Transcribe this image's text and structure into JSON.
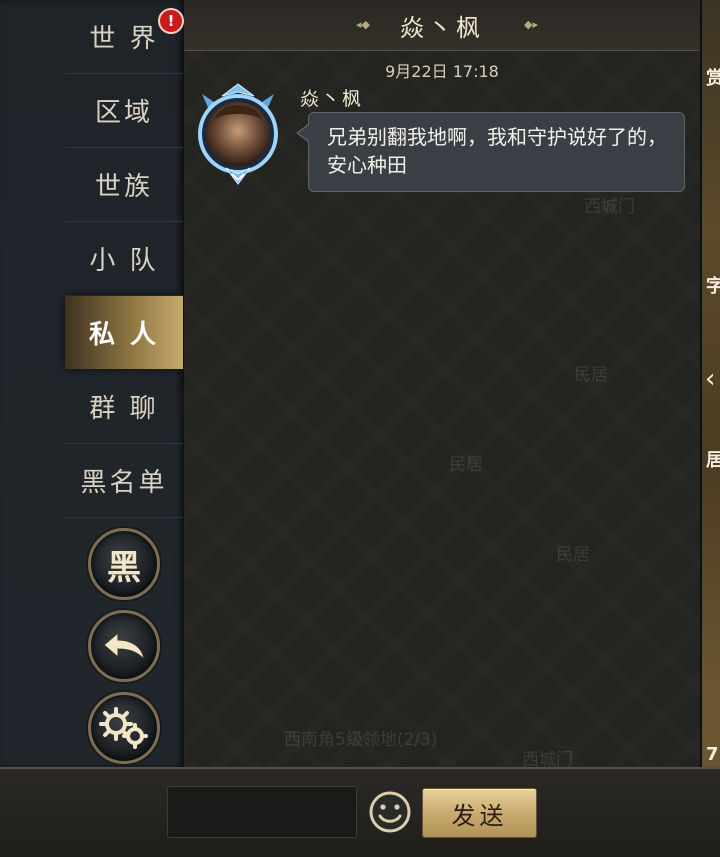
{
  "sidebar": {
    "tabs": [
      {
        "label": "世 界",
        "badge": "!"
      },
      {
        "label": "区域"
      },
      {
        "label": "世族"
      },
      {
        "label": "小 队"
      },
      {
        "label": "私 人",
        "active": true
      },
      {
        "label": "群 聊"
      },
      {
        "label": "黑名单"
      }
    ],
    "buttons": {
      "blacklist_label": "黑",
      "back_icon": "back-arrow-icon",
      "settings_icon": "gear-icon"
    }
  },
  "chat": {
    "title": "焱丶枫",
    "timestamp": "9月22日 17:18",
    "messages": [
      {
        "sender": "焱丶枫",
        "text": "兄弟别翻我地啊，我和守护说好了的，安心种田"
      }
    ],
    "background_labels": [
      "西城门",
      "民居",
      "民居",
      "民居",
      "西南角5级领地(2/3)",
      "西城门"
    ]
  },
  "right_strip": {
    "chars": [
      "赏",
      "字",
      "居",
      "7"
    ]
  },
  "input": {
    "value": "",
    "placeholder": ""
  },
  "send_label": "发送",
  "colors": {
    "active_tab_gold": "#c7ab6c",
    "send_button_gold": "#d9bf86",
    "sidebar_bg": "#20262b",
    "bubble_bg": "#3a3f45"
  }
}
